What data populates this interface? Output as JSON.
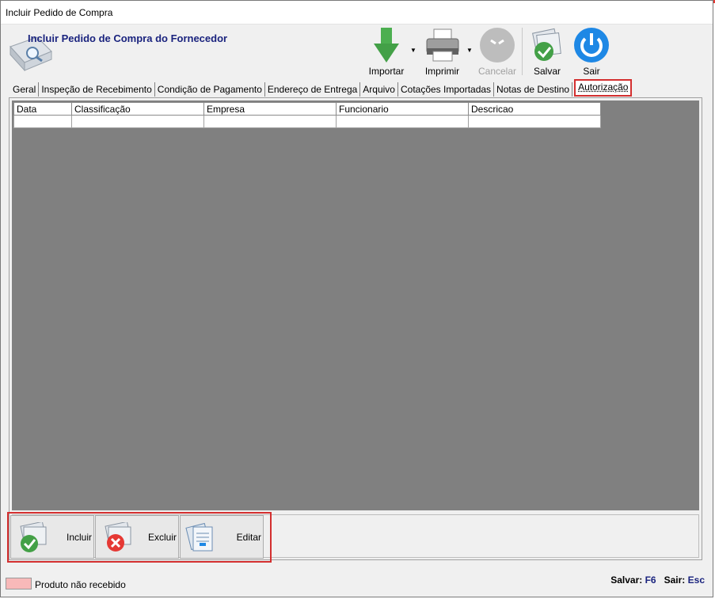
{
  "window": {
    "title": "Incluir Pedido de Compra"
  },
  "header": {
    "title": "Incluir Pedido de Compra do Fornecedor"
  },
  "toolbar": {
    "importar": "Importar",
    "imprimir": "Imprimir",
    "cancelar": "Cancelar",
    "salvar": "Salvar",
    "sair": "Sair"
  },
  "tabs": [
    {
      "label": "Geral"
    },
    {
      "label": "Inspeção de Recebimento"
    },
    {
      "label": "Condição de Pagamento"
    },
    {
      "label": "Endereço de Entrega"
    },
    {
      "label": "Arquivo"
    },
    {
      "label": "Cotações Importadas"
    },
    {
      "label": "Notas de Destino"
    },
    {
      "label": "Autorização"
    }
  ],
  "active_tab": "Autorização",
  "grid": {
    "columns": [
      "Data",
      "Classificação",
      "Empresa",
      "Funcionario",
      "Descricao"
    ]
  },
  "actions": {
    "incluir": "Incluir",
    "excluir": "Excluir",
    "editar": "Editar"
  },
  "legend": {
    "label": "Produto não recebido",
    "color": "#f8b9b9"
  },
  "shortcuts": {
    "salvar_label": "Salvar:",
    "salvar_key": "F6",
    "sair_label": "Sair:",
    "sair_key": "Esc"
  }
}
